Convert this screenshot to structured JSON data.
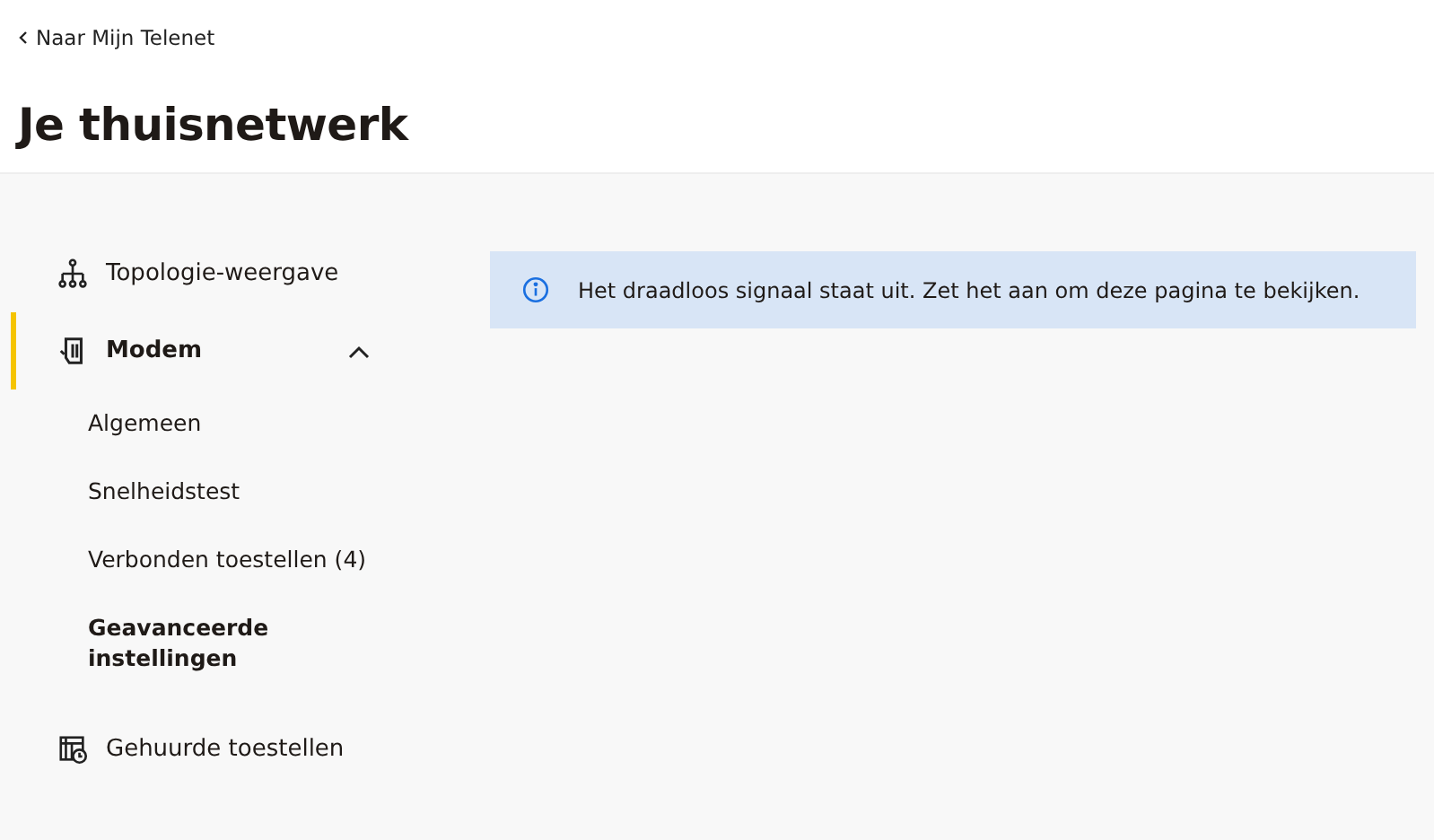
{
  "back_link": {
    "label": "Naar Mijn Telenet"
  },
  "page_title": "Je thuisnetwerk",
  "sidebar": {
    "items": [
      {
        "label": "Topologie-weergave",
        "kind": "topology",
        "selected": false
      },
      {
        "label": "Modem",
        "kind": "modem",
        "selected": true,
        "expanded": true,
        "children": [
          {
            "label": "Algemeen",
            "selected": false
          },
          {
            "label": "Snelheidstest",
            "selected": false
          },
          {
            "label": "Verbonden toestellen (4)",
            "selected": false
          },
          {
            "label": "Geavanceerde instellingen",
            "selected": true
          }
        ]
      },
      {
        "label": "Gehuurde toestellen",
        "kind": "rented",
        "selected": false
      }
    ]
  },
  "alert": {
    "kind": "info",
    "message": "Het draadloos signaal staat uit. Zet het aan om deze pagina te bekijken."
  }
}
